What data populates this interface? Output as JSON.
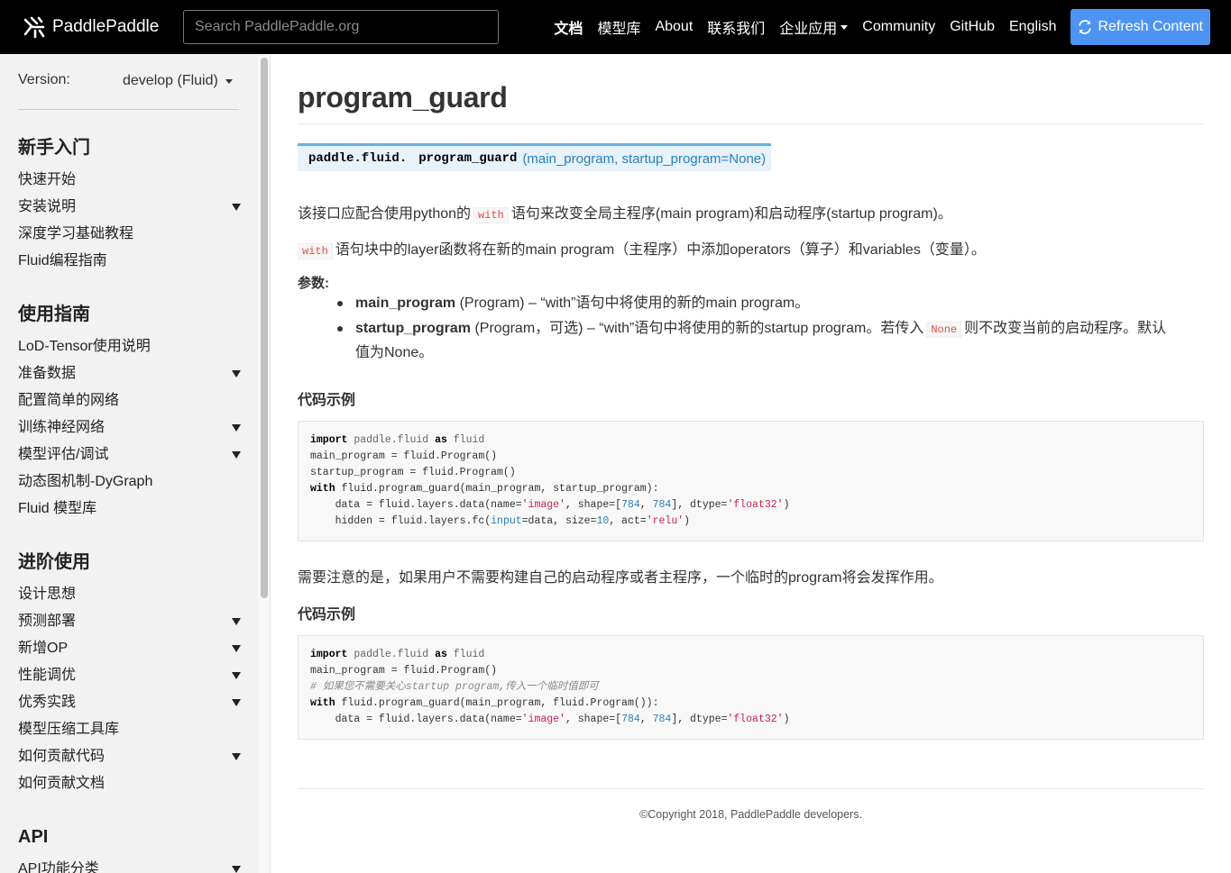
{
  "header": {
    "brand": "PaddlePaddle",
    "search_placeholder": "Search PaddlePaddle.org",
    "nav": [
      {
        "label": "文档",
        "active": true
      },
      {
        "label": "模型库"
      },
      {
        "label": "About"
      },
      {
        "label": "联系我们"
      },
      {
        "label": "企业应用",
        "dropdown": true
      },
      {
        "label": "Community"
      },
      {
        "label": "GitHub"
      },
      {
        "label": "English"
      }
    ],
    "refresh_label": "Refresh Content"
  },
  "sidebar": {
    "version_label": "Version:",
    "version_value": "develop (Fluid)",
    "sections": [
      {
        "heading": "新手入门",
        "items": [
          {
            "label": "快速开始"
          },
          {
            "label": "安装说明",
            "expandable": true
          },
          {
            "label": "深度学习基础教程"
          },
          {
            "label": "Fluid编程指南"
          }
        ]
      },
      {
        "heading": "使用指南",
        "items": [
          {
            "label": "LoD-Tensor使用说明"
          },
          {
            "label": "准备数据",
            "expandable": true
          },
          {
            "label": "配置简单的网络"
          },
          {
            "label": "训练神经网络",
            "expandable": true
          },
          {
            "label": "模型评估/调试",
            "expandable": true
          },
          {
            "label": "动态图机制-DyGraph"
          },
          {
            "label": "Fluid 模型库"
          }
        ]
      },
      {
        "heading": "进阶使用",
        "items": [
          {
            "label": "设计思想"
          },
          {
            "label": "预测部署",
            "expandable": true
          },
          {
            "label": "新增OP",
            "expandable": true
          },
          {
            "label": "性能调优",
            "expandable": true
          },
          {
            "label": "优秀实践",
            "expandable": true
          },
          {
            "label": "模型压缩工具库"
          },
          {
            "label": "如何贡献代码",
            "expandable": true
          },
          {
            "label": "如何贡献文档"
          }
        ]
      },
      {
        "heading": "API",
        "items": [
          {
            "label": "API功能分类",
            "expandable": true
          }
        ]
      }
    ]
  },
  "main": {
    "title": "program_guard",
    "signature": {
      "prefix": "paddle.fluid.",
      "name": "program_guard",
      "params": "(main_program, startup_program=None)"
    },
    "desc1": {
      "before": "该接口应配合使用python的",
      "code": "with",
      "after": "语句来改变全局主程序(main program)和启动程序(startup program)。"
    },
    "desc2": {
      "code": "with",
      "after": "语句块中的layer函数将在新的main program（主程序）中添加operators（算子）和variables（变量）。"
    },
    "params_label": "参数:",
    "params": [
      {
        "name": "main_program",
        "desc": " (Program) – “with”语句中将使用的新的main program。"
      },
      {
        "name": "startup_program",
        "desc": " (Program，可选) – “with”语句中将使用的新的startup program。若传入",
        "code": "None",
        "desc2": "则不改变当前的启动程序。默认",
        "desc3": "值为None。"
      }
    ],
    "example_heading_1": "代码示例",
    "code1": [
      "import paddle.fluid as fluid",
      "main_program = fluid.Program()",
      "startup_program = fluid.Program()",
      "with fluid.program_guard(main_program, startup_program):",
      "    data = fluid.layers.data(name='image', shape=[784, 784], dtype='float32')",
      "    hidden = fluid.layers.fc(input=data, size=10, act='relu')"
    ],
    "note": "需要注意的是，如果用户不需要构建自己的启动程序或者主程序，一个临时的program将会发挥作用。",
    "example_heading_2": "代码示例",
    "code2": [
      "import paddle.fluid as fluid",
      "main_program = fluid.Program()",
      "# 如果您不需要关心startup program,传入一个临时值即可",
      "with fluid.program_guard(main_program, fluid.Program()):",
      "    data = fluid.layers.data(name='image', shape=[784, 784], dtype='float32')"
    ],
    "footer": "©Copyright 2018, PaddlePaddle developers."
  }
}
